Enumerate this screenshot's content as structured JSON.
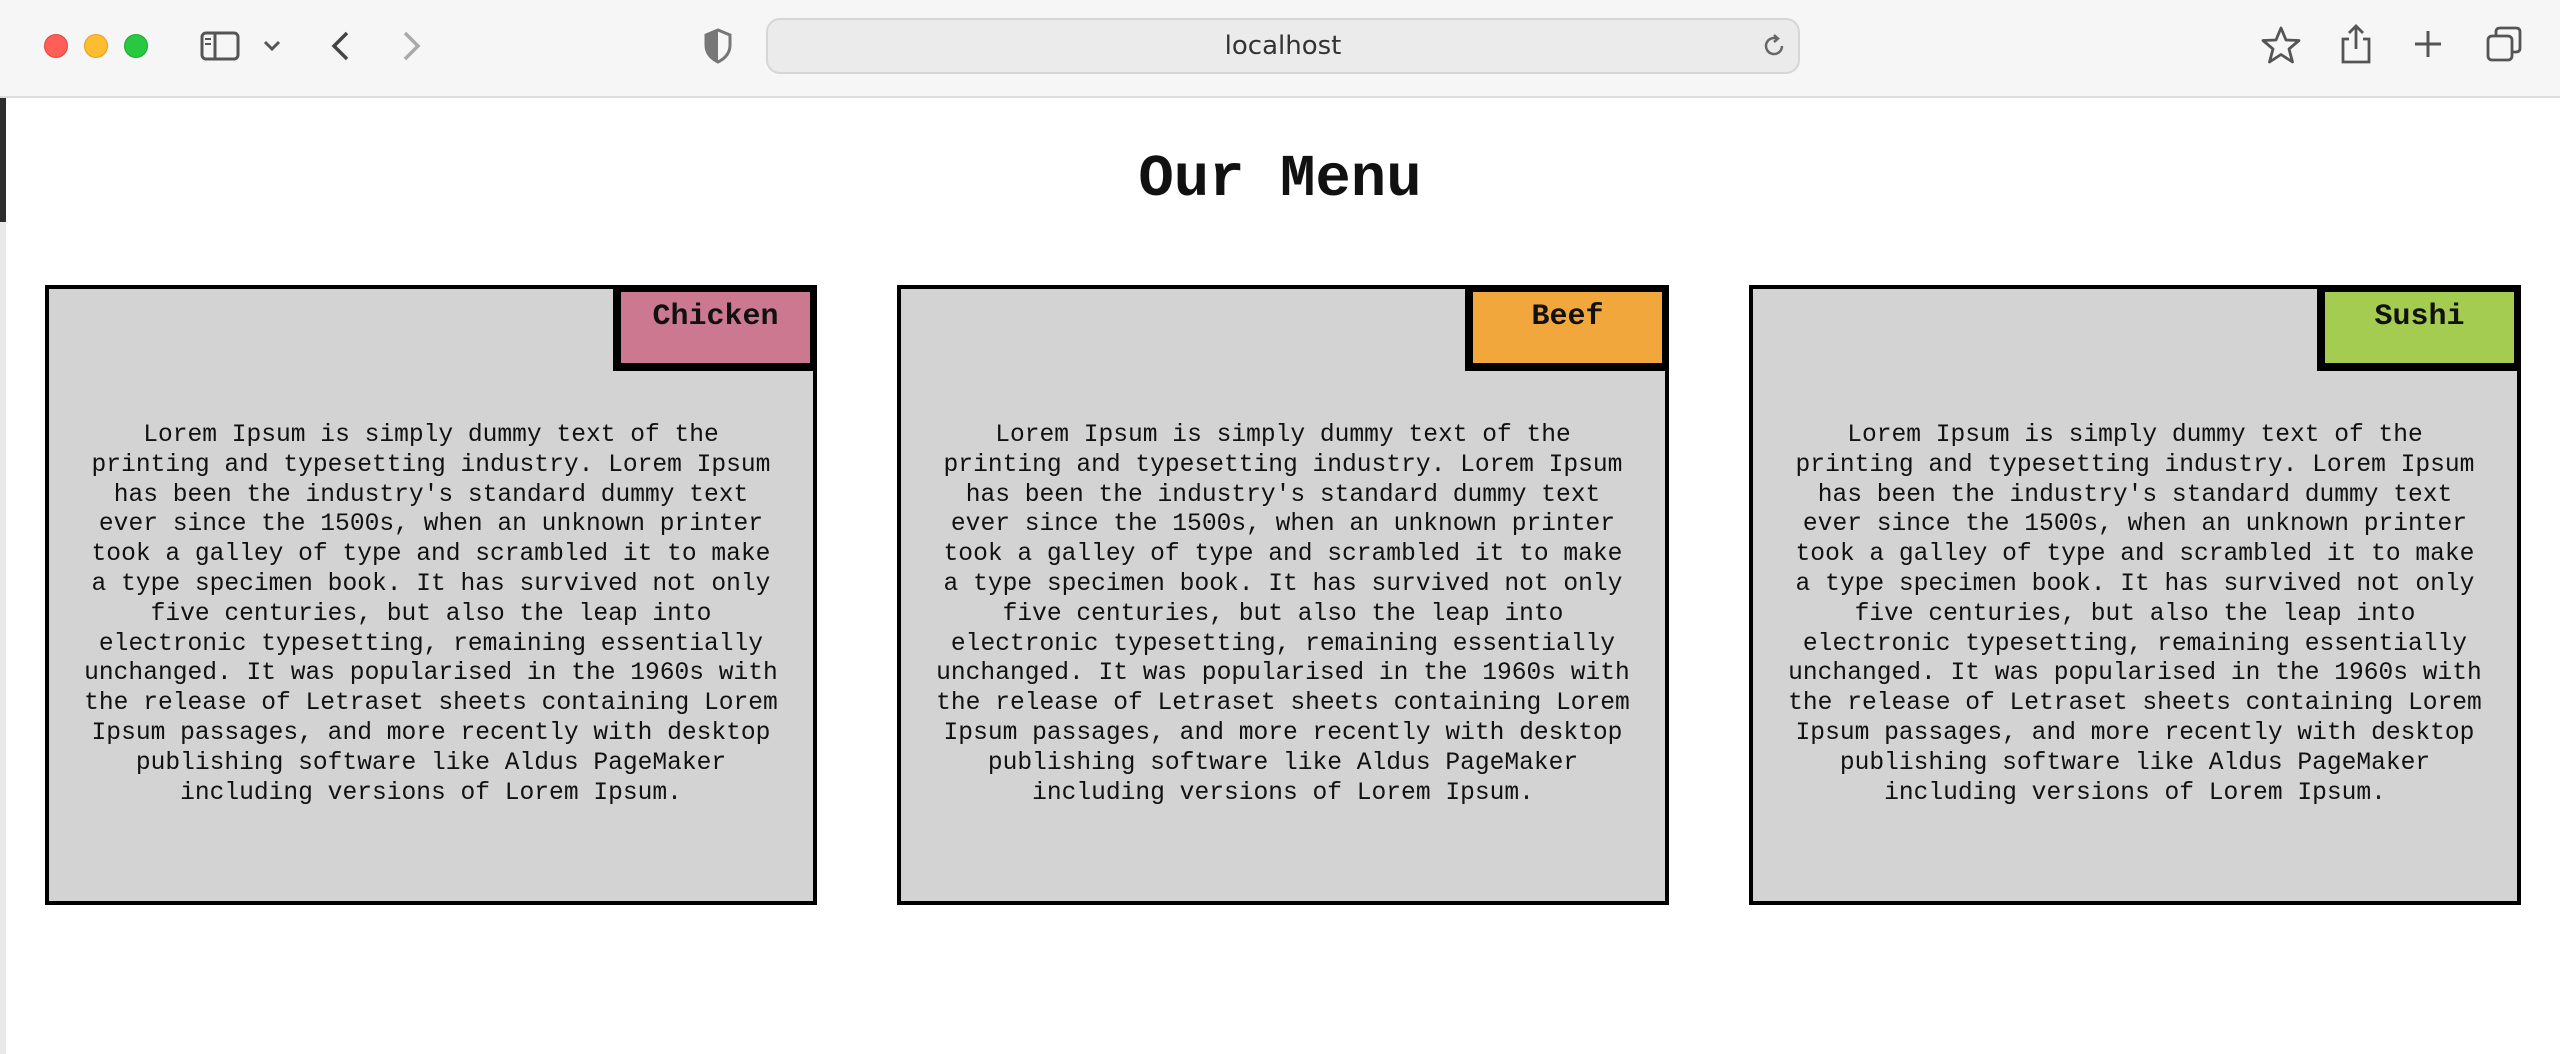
{
  "browser": {
    "address": "localhost",
    "icons": [
      "sidebar-icon",
      "chevron-down-icon",
      "back-icon",
      "forward-icon",
      "shield-icon",
      "reload-icon",
      "star-icon",
      "share-icon",
      "plus-icon",
      "tabs-icon"
    ]
  },
  "page": {
    "title": "Our Menu"
  },
  "cards": [
    {
      "label": "Chicken",
      "color": "#cc7891",
      "text": "Lorem Ipsum is simply dummy text of the printing and typesetting industry. Lorem Ipsum has been the industry's standard dummy text ever since the 1500s, when an unknown printer took a galley of type and scrambled it to make a type specimen book. It has survived not only five centuries, but also the leap into electronic typesetting, remaining essentially unchanged. It was popularised in the 1960s with the release of Letraset sheets containing Lorem Ipsum passages, and more recently with desktop publishing software like Aldus PageMaker including versions of Lorem Ipsum."
    },
    {
      "label": "Beef",
      "color": "#f1a73c",
      "text": "Lorem Ipsum is simply dummy text of the printing and typesetting industry. Lorem Ipsum has been the industry's standard dummy text ever since the 1500s, when an unknown printer took a galley of type and scrambled it to make a type specimen book. It has survived not only five centuries, but also the leap into electronic typesetting, remaining essentially unchanged. It was popularised in the 1960s with the release of Letraset sheets containing Lorem Ipsum passages, and more recently with desktop publishing software like Aldus PageMaker including versions of Lorem Ipsum."
    },
    {
      "label": "Sushi",
      "color": "#a4cc50",
      "text": "Lorem Ipsum is simply dummy text of the printing and typesetting industry. Lorem Ipsum has been the industry's standard dummy text ever since the 1500s, when an unknown printer took a galley of type and scrambled it to make a type specimen book. It has survived not only five centuries, but also the leap into electronic typesetting, remaining essentially unchanged. It was popularised in the 1960s with the release of Letraset sheets containing Lorem Ipsum passages, and more recently with desktop publishing software like Aldus PageMaker including versions of Lorem Ipsum."
    }
  ]
}
